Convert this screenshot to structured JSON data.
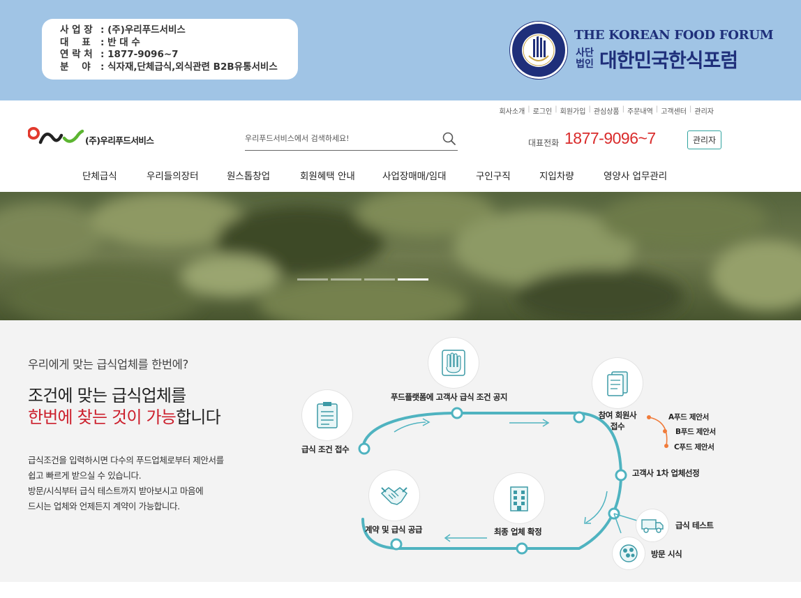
{
  "top_banner": {
    "info": [
      {
        "key": "사 업 장",
        "value": ": (주)우리푸드서비스"
      },
      {
        "key": "대    표",
        "value": ": 반 대 수"
      },
      {
        "key": "연 락 처",
        "value": ": 1877-9096~7"
      },
      {
        "key": "분    야",
        "value": ": 식자재,단체급식,외식관련 B2B유통서비스"
      }
    ],
    "forum_en": "THE KOREAN FOOD FORUM",
    "forum_sub": "사단법인",
    "forum_ko": "대한민국한식포럼"
  },
  "util_nav": [
    "회사소개",
    "로그인",
    "회원가입",
    "관심상품",
    "주문내역",
    "고객센터",
    "관리자"
  ],
  "header": {
    "logo_text": "(주)우리푸드서비스",
    "search_placeholder": "우리푸드서비스에서 검색하세요!",
    "phone_label": "대표전화",
    "phone": "1877-9096~7",
    "admin_label": "관리자"
  },
  "main_nav": [
    "단체급식",
    "우리들의장터",
    "원스톱창업",
    "회원혜택 안내",
    "사업장매매/임대",
    "구인구직",
    "지입차량",
    "영양사 업무관리"
  ],
  "hero": {
    "slide_count": 4,
    "active_slide": 4
  },
  "intro": {
    "lead": "우리에게 맞는 급식업체를 한번에?",
    "headline_1": "조건에 맞는 급식업체를",
    "headline_2_red": "한번에 찾는 것이 가능",
    "headline_2_rest": "합니다",
    "desc": [
      "급식조건을 입력하시면 다수의 푸드업체로부터 제안서를",
      "쉽고 빠르게 받으실 수 있습니다.",
      "방문/시식부터 급식 테스트까지 받아보시고 마음에",
      "드시는 업체와 언제든지 계약이 가능합니다."
    ]
  },
  "process": {
    "step_receive": "급식 조건 접수",
    "step_notice": "푸드플랫폼에 고객사 급식 조건 공지",
    "step_member_1": "참여 회원사",
    "step_member_2": "접수",
    "proposals": [
      "A푸드 제안서",
      "B푸드 제안서",
      "C푸드 제안서"
    ],
    "step_select": "고객사 1차 업체선정",
    "step_test": "급식 테스트",
    "step_visit": "방문 시식",
    "step_final": "최종 업체 확정",
    "step_contract": "계약 및 급식 공급",
    "colors": {
      "track": "#4fb3c0",
      "proposal": "#f07b3a",
      "accent_red": "#cc1f2c",
      "phone_red": "#d92b2b"
    }
  }
}
